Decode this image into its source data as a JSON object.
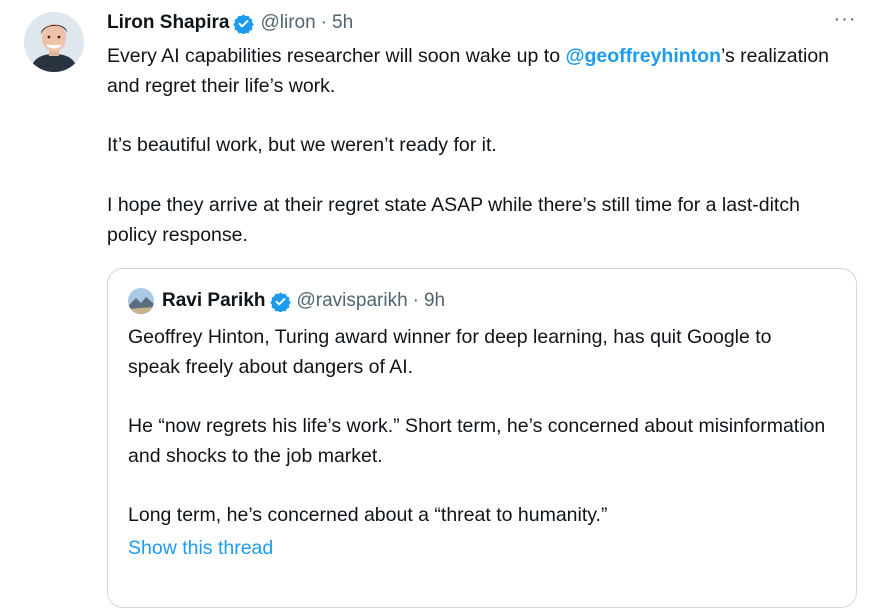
{
  "tweet": {
    "author_name": "Liron Shapira",
    "author_handle": "@liron",
    "separator": "·",
    "time": "5h",
    "more_label": "···",
    "text_line1_pre": "Every AI capabilities researcher will soon wake up to ",
    "mention": "@geoffreyhinton",
    "text_line1_post": "’s realization and regret their life’s work.",
    "paragraph2": "It’s beautiful work, but we weren’t ready for it.",
    "paragraph3": "I hope they arrive at their regret state ASAP while there’s still time for a last-ditch policy response."
  },
  "quoted": {
    "author_name": "Ravi Parikh",
    "author_handle": "@ravisparikh",
    "separator": "·",
    "time": "9h",
    "paragraph1": "Geoffrey Hinton, Turing award winner for deep learning, has quit Google to speak freely about dangers of AI.",
    "paragraph2": "He “now regrets his life’s work.” Short term, he’s concerned about misinformation and shocks to the job market.",
    "paragraph3": "Long term, he’s concerned about a “threat to humanity.”",
    "show_thread": "Show this thread"
  },
  "colors": {
    "link": "#1d9bf0",
    "secondary_text": "#536471",
    "border": "#cfd9de",
    "verified": "#1d9bf0"
  },
  "icons": {
    "verified": "verified-badge-icon",
    "more": "more-horizontal-icon"
  }
}
